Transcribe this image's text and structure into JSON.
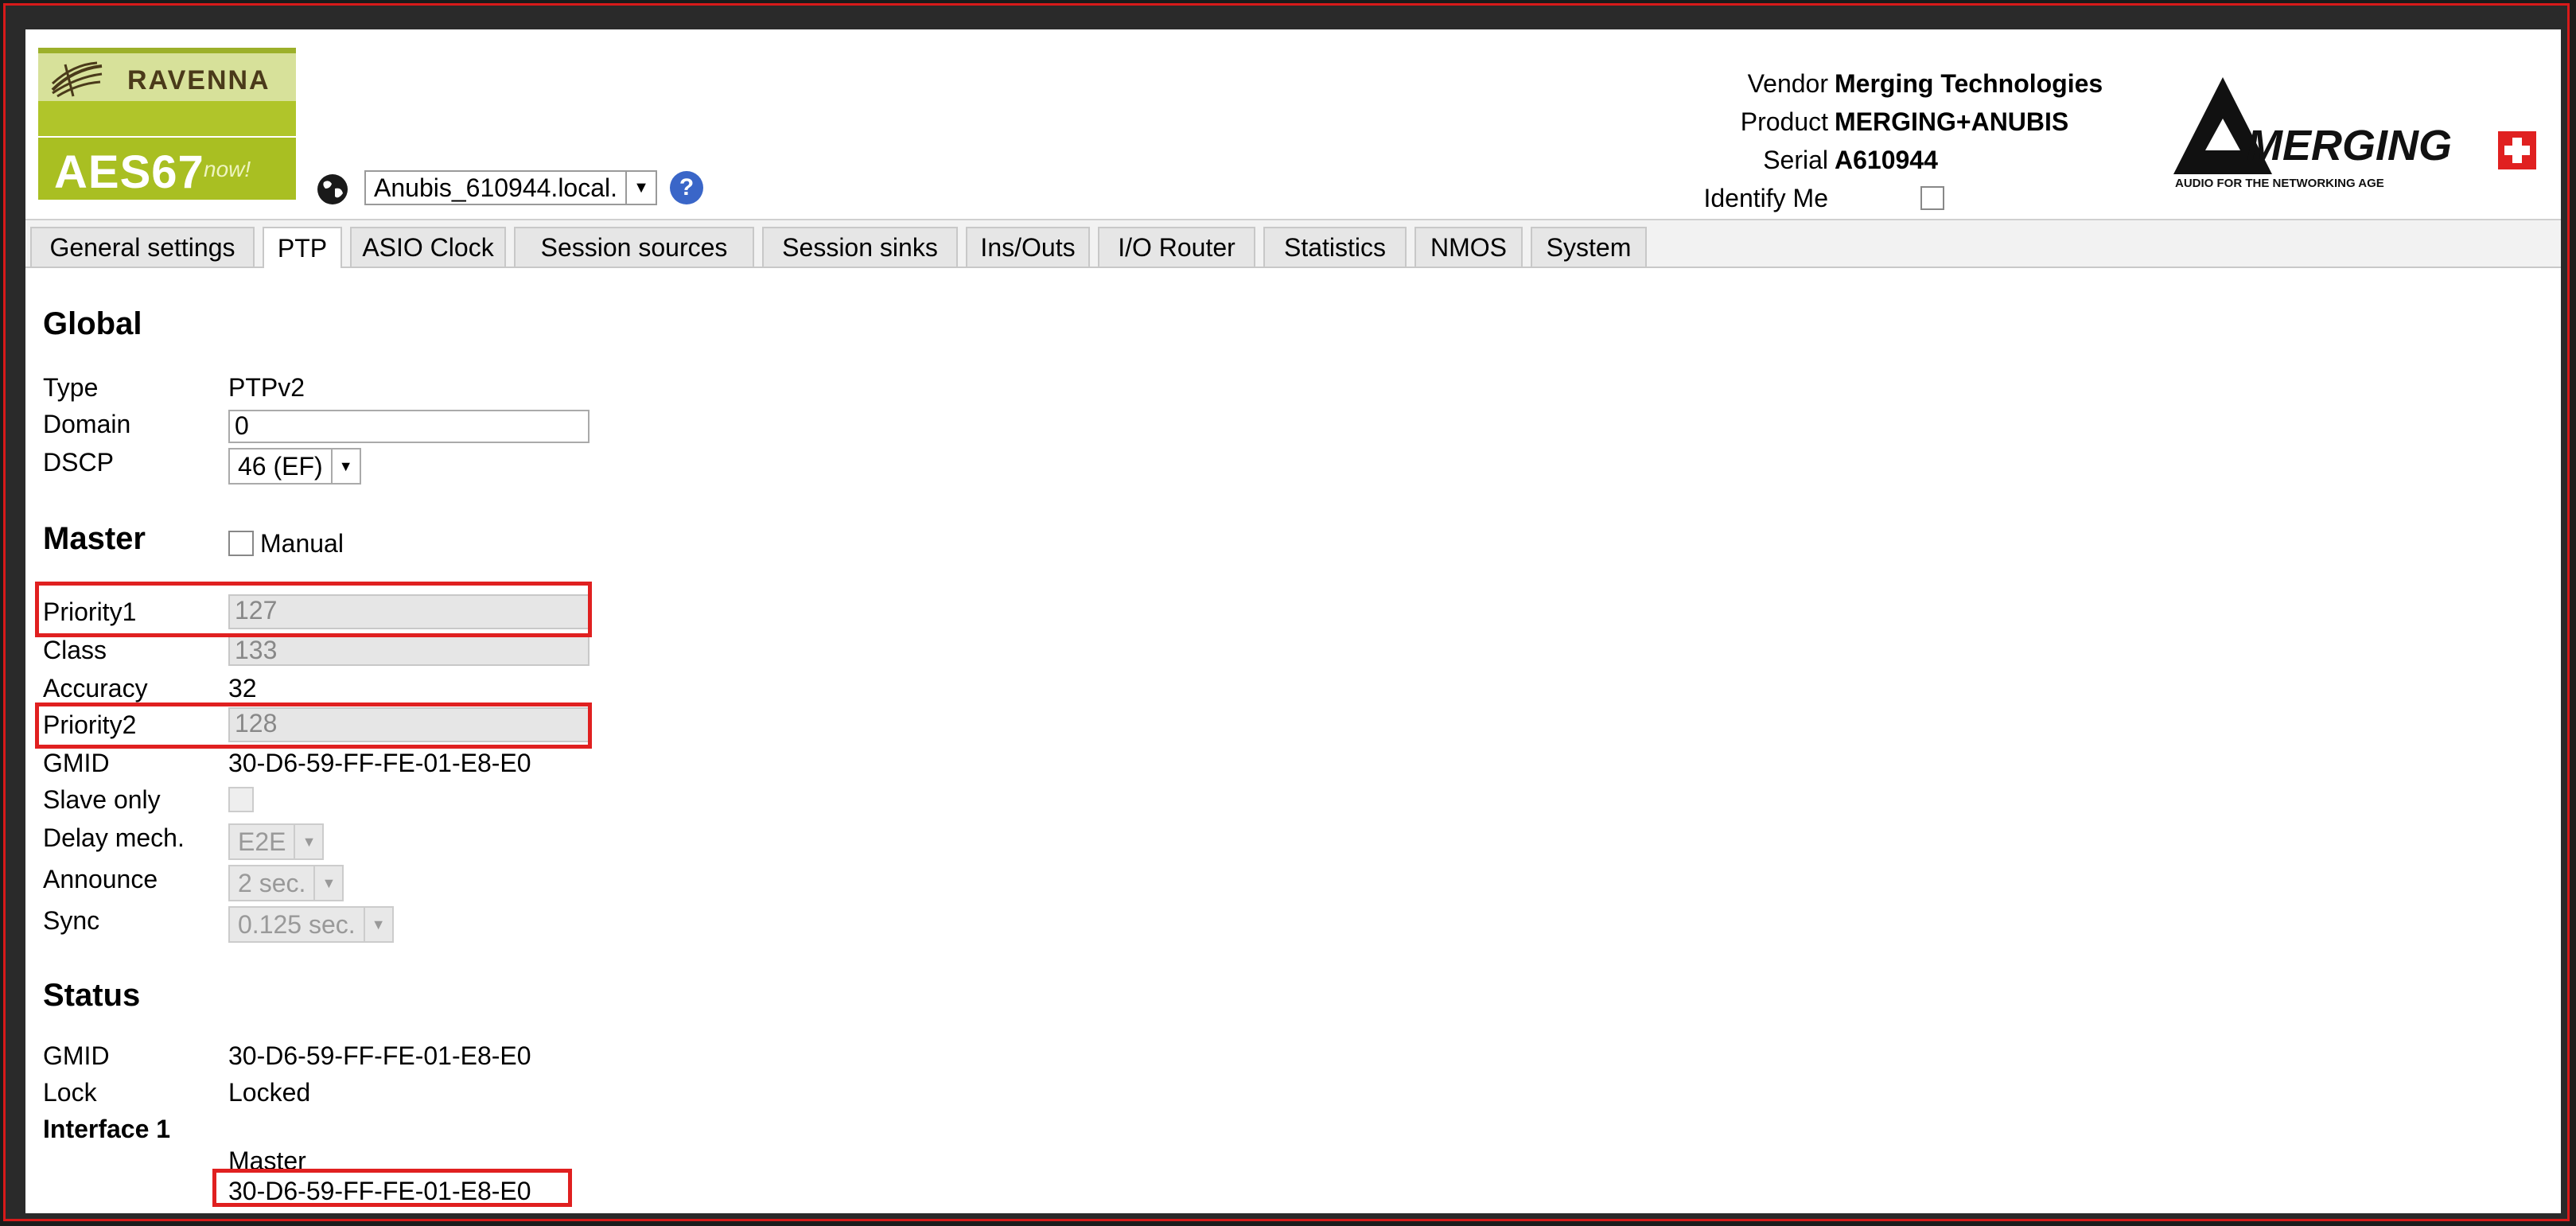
{
  "header": {
    "ravenna_logo_text": "RAVENNA",
    "aes_logo_text": "AES67",
    "aes_logo_now": "now!",
    "device_select_value": "Anubis_610944.local.",
    "vendor_label": "Vendor",
    "vendor_value": "Merging Technologies",
    "product_label": "Product",
    "product_value": "MERGING+ANUBIS",
    "serial_label": "Serial",
    "serial_value": "A610944",
    "identify_label": "Identify Me",
    "merging_logo_text": "MERGING",
    "merging_logo_tagline": "AUDIO FOR THE NETWORKING AGE"
  },
  "tabs": [
    {
      "label": "General settings"
    },
    {
      "label": "PTP"
    },
    {
      "label": "ASIO Clock"
    },
    {
      "label": "Session sources"
    },
    {
      "label": "Session sinks"
    },
    {
      "label": "Ins/Outs"
    },
    {
      "label": "I/O Router"
    },
    {
      "label": "Statistics"
    },
    {
      "label": "NMOS"
    },
    {
      "label": "System"
    }
  ],
  "active_tab": "PTP",
  "global": {
    "heading": "Global",
    "type_label": "Type",
    "type_value": "PTPv2",
    "domain_label": "Domain",
    "domain_value": "0",
    "dscp_label": "DSCP",
    "dscp_value": "46 (EF)"
  },
  "master": {
    "heading": "Master",
    "manual_label": "Manual",
    "priority1_label": "Priority1",
    "priority1_value": "127",
    "class_label": "Class",
    "class_value": "133",
    "accuracy_label": "Accuracy",
    "accuracy_value": "32",
    "priority2_label": "Priority2",
    "priority2_value": "128",
    "gmid_label": "GMID",
    "gmid_value": "30-D6-59-FF-FE-01-E8-E0",
    "slave_only_label": "Slave only",
    "delay_label": "Delay mech.",
    "delay_value": "E2E",
    "announce_label": "Announce",
    "announce_value": "2 sec.",
    "sync_label": "Sync",
    "sync_value": "0.125 sec."
  },
  "status": {
    "heading": "Status",
    "gmid_label": "GMID",
    "gmid_value": "30-D6-59-FF-FE-01-E8-E0",
    "lock_label": "Lock",
    "lock_value": "Locked",
    "interface_heading": "Interface 1",
    "master_label": "Master",
    "master_value": "30-D6-59-FF-FE-01-E8-E0"
  },
  "colors": {
    "highlight": "#e02020",
    "ravenna_green": "#a9bf22",
    "merging_red": "#e02020"
  }
}
